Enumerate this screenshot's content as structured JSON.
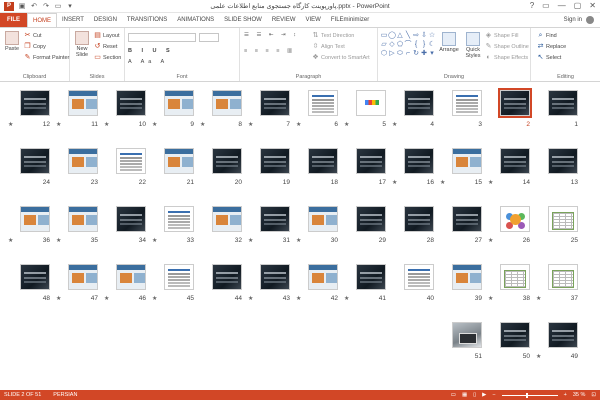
{
  "app": {
    "window_title": "پاورپوینت کارگاه جستجوی منابع اطلاعات علمی.pptx - PowerPoint",
    "logo_letter": "P",
    "window_buttons": [
      "?",
      "▭",
      "—",
      "▢",
      "✕"
    ]
  },
  "quick_access": [
    "save-icon",
    "undo-icon",
    "redo-icon",
    "present-icon",
    "customize-icon"
  ],
  "tabs": [
    "FILE",
    "HOME",
    "INSERT",
    "DESIGN",
    "TRANSITIONS",
    "ANIMATIONS",
    "SLIDE SHOW",
    "REVIEW",
    "VIEW",
    "FILEminimizer"
  ],
  "active_tab": "HOME",
  "signin_label": "Sign in",
  "ribbon": {
    "clipboard": {
      "label": "Clipboard",
      "paste": "Paste",
      "cut": "Cut",
      "copy": "Copy",
      "format_painter": "Format Painter"
    },
    "slides": {
      "label": "Slides",
      "new_slide": "New Slide",
      "layout": "Layout",
      "reset": "Reset",
      "section": "Section"
    },
    "font": {
      "label": "Font"
    },
    "paragraph": {
      "label": "Paragraph",
      "text_direction": "Text Direction",
      "align_text": "Align Text",
      "convert": "Convert to SmartArt"
    },
    "drawing": {
      "label": "Drawing",
      "arrange": "Arrange",
      "quick_styles": "Quick Styles",
      "shape_fill": "Shape Fill",
      "shape_outline": "Shape Outline",
      "shape_effects": "Shape Effects"
    },
    "editing": {
      "label": "Editing",
      "find": "Find",
      "replace": "Replace",
      "select": "Select"
    }
  },
  "slides": [
    {
      "n": "1",
      "kind": "dark",
      "star": false
    },
    {
      "n": "2",
      "kind": "dark",
      "star": false,
      "selected": true
    },
    {
      "n": "3",
      "kind": "light",
      "star": false
    },
    {
      "n": "4",
      "kind": "dark",
      "star": true
    },
    {
      "n": "5",
      "kind": "google",
      "star": true
    },
    {
      "n": "6",
      "kind": "light",
      "star": true
    },
    {
      "n": "7",
      "kind": "dark",
      "star": true
    },
    {
      "n": "8",
      "kind": "web",
      "star": true
    },
    {
      "n": "9",
      "kind": "web",
      "star": true
    },
    {
      "n": "10",
      "kind": "dark",
      "star": true
    },
    {
      "n": "11",
      "kind": "web",
      "star": true
    },
    {
      "n": "12",
      "kind": "dark",
      "star": true
    },
    {
      "n": "13",
      "kind": "dark",
      "star": false
    },
    {
      "n": "14",
      "kind": "dark",
      "star": true
    },
    {
      "n": "15",
      "kind": "web",
      "star": true
    },
    {
      "n": "16",
      "kind": "dark",
      "star": true
    },
    {
      "n": "17",
      "kind": "dark",
      "star": false
    },
    {
      "n": "18",
      "kind": "dark",
      "star": false
    },
    {
      "n": "19",
      "kind": "dark",
      "star": false
    },
    {
      "n": "20",
      "kind": "dark",
      "star": false
    },
    {
      "n": "21",
      "kind": "web",
      "star": false
    },
    {
      "n": "22",
      "kind": "light",
      "star": false
    },
    {
      "n": "23",
      "kind": "web",
      "star": false
    },
    {
      "n": "24",
      "kind": "dark",
      "star": false
    },
    {
      "n": "25",
      "kind": "table",
      "star": false
    },
    {
      "n": "26",
      "kind": "diagram",
      "star": true
    },
    {
      "n": "27",
      "kind": "dark",
      "star": false
    },
    {
      "n": "28",
      "kind": "dark",
      "star": false
    },
    {
      "n": "29",
      "kind": "dark",
      "star": false
    },
    {
      "n": "30",
      "kind": "web",
      "star": true
    },
    {
      "n": "31",
      "kind": "dark",
      "star": true
    },
    {
      "n": "32",
      "kind": "web",
      "star": false
    },
    {
      "n": "33",
      "kind": "light",
      "star": true
    },
    {
      "n": "34",
      "kind": "dark",
      "star": false
    },
    {
      "n": "35",
      "kind": "web",
      "star": true
    },
    {
      "n": "36",
      "kind": "web",
      "star": true
    },
    {
      "n": "37",
      "kind": "table",
      "star": true
    },
    {
      "n": "38",
      "kind": "table",
      "star": true
    },
    {
      "n": "39",
      "kind": "web",
      "star": false
    },
    {
      "n": "40",
      "kind": "light",
      "star": false
    },
    {
      "n": "41",
      "kind": "dark",
      "star": true
    },
    {
      "n": "42",
      "kind": "web",
      "star": true
    },
    {
      "n": "43",
      "kind": "dark",
      "star": true
    },
    {
      "n": "44",
      "kind": "dark",
      "star": false
    },
    {
      "n": "45",
      "kind": "light",
      "star": true
    },
    {
      "n": "46",
      "kind": "web",
      "star": true
    },
    {
      "n": "47",
      "kind": "web",
      "star": true
    },
    {
      "n": "48",
      "kind": "dark",
      "star": false
    },
    {
      "n": "49",
      "kind": "dark",
      "star": true
    },
    {
      "n": "50",
      "kind": "dark",
      "star": false
    },
    {
      "n": "51",
      "kind": "photo",
      "star": false
    }
  ],
  "status": {
    "slide_info": "SLIDE 2 OF 51",
    "language": "PERSIAN",
    "zoom": "35 %"
  },
  "colors": {
    "accent": "#d24726"
  }
}
